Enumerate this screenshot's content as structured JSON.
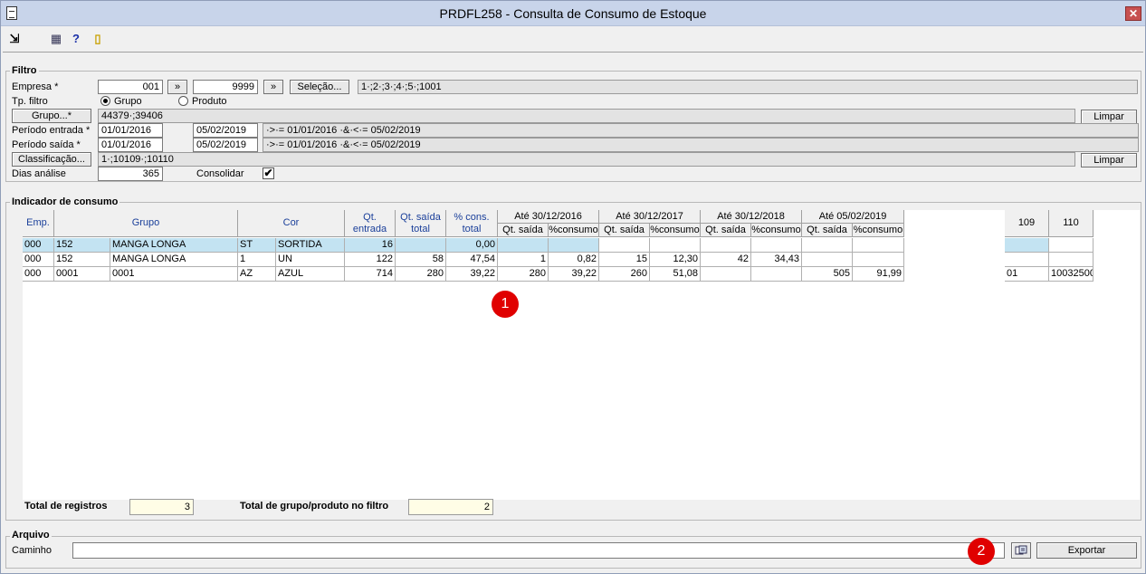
{
  "window": {
    "title": "PRDFL258 - Consulta de Consumo de Estoque",
    "close_glyph": "✕"
  },
  "filtro": {
    "title": "Filtro",
    "empresa_label": "Empresa *",
    "empresa_de": "001",
    "empresa_ate": "9999",
    "arrow_btn": "»",
    "selecao_btn": "Seleção...",
    "empresa_sel": "1·;2·;3·;4·;5·;1001",
    "tp_filtro_label": "Tp. filtro",
    "grupo_radio": "Grupo",
    "produto_radio": "Produto",
    "grupo_btn": "Grupo...*",
    "grupo_value": "44379·;39406",
    "limpar": "Limpar",
    "entrada_label": "Período entrada *",
    "entrada_de": "01/01/2016",
    "entrada_ate": "05/02/2019",
    "entrada_expr": "·>·= 01/01/2016 ·&·<·= 05/02/2019",
    "saida_label": "Período saída *",
    "saida_de": "01/01/2016",
    "saida_ate": "05/02/2019",
    "saida_expr": "·>·= 01/01/2016 ·&·<·= 05/02/2019",
    "classificacao_btn": "Classificação...",
    "classificacao_value": "1·;10109·;10110",
    "dias_label": "Dias análise",
    "dias_value": "365",
    "consolidar_label": "Consolidar",
    "check_glyph": "✔"
  },
  "indicador": {
    "title": "Indicador de consumo",
    "headers": {
      "emp": "Emp.",
      "grupo": "Grupo",
      "cor": "Cor",
      "qt_entrada": "Qt. entrada",
      "qt_saida_total": "Qt. saída total",
      "pct_cons_total": "% cons. total",
      "p1": "Até 30/12/2016",
      "p2": "Até 30/12/2017",
      "p3": "Até 30/12/2018",
      "p4": "Até 05/02/2019",
      "qt_saida": "Qt. saída",
      "pct_consumo": "%consumo",
      "c109": "109",
      "c110": "110"
    },
    "rows": [
      {
        "emp": "000",
        "grp": "152",
        "grp_desc": "MANGA LONGA",
        "cor": "ST",
        "cor_desc": "SORTIDA",
        "qte": "16",
        "qts": "",
        "pct": "0,00",
        "a1": "",
        "b1": "",
        "a2": "",
        "b2": "",
        "a3": "",
        "b3": "",
        "a4": "",
        "b4": "",
        "c109": "",
        "c110": ""
      },
      {
        "emp": "000",
        "grp": "152",
        "grp_desc": "MANGA LONGA",
        "cor": "1",
        "cor_desc": "UN",
        "qte": "122",
        "qts": "58",
        "pct": "47,54",
        "a1": "1",
        "b1": "0,82",
        "a2": "15",
        "b2": "12,30",
        "a3": "42",
        "b3": "34,43",
        "a4": "",
        "b4": "",
        "c109": "",
        "c110": ""
      },
      {
        "emp": "000",
        "grp": "0001",
        "grp_desc": "0001",
        "cor": "AZ",
        "cor_desc": "AZUL",
        "qte": "714",
        "qts": "280",
        "pct": "39,22",
        "a1": "280",
        "b1": "39,22",
        "a2": "260",
        "b2": "51,08",
        "a3": "",
        "b3": "",
        "a4": "505",
        "b4": "91,99",
        "c109": "01",
        "c110": "10032500"
      }
    ],
    "total_registros_label": "Total de registros",
    "total_registros": "3",
    "total_grupo_label": "Total de grupo/produto no filtro",
    "total_grupo": "2"
  },
  "arquivo": {
    "title": "Arquivo",
    "caminho_label": "Caminho",
    "caminho_value": "",
    "exportar": "Exportar"
  },
  "badges": {
    "one": "1",
    "two": "2"
  },
  "toolbar": {
    "exit_glyph": "⇲",
    "grid_glyph": "▦",
    "help_glyph": "?",
    "door_glyph": "▯"
  }
}
